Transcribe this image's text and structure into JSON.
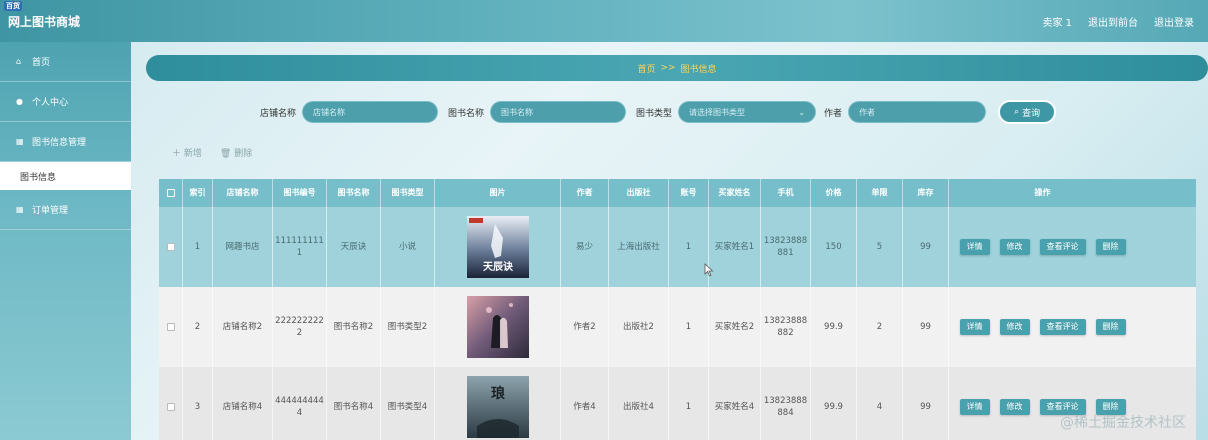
{
  "header": {
    "badge": "百货",
    "title": "网上图书商城",
    "user": "卖家 1",
    "back_to_admin": "退出到前台",
    "logout": "退出登录"
  },
  "sidebar": {
    "items": [
      {
        "label": "首页"
      },
      {
        "label": "个人中心"
      },
      {
        "label": "图书信息管理"
      },
      {
        "label": "订单管理"
      }
    ],
    "sub_item": "图书信息"
  },
  "breadcrumb": {
    "home": "首页",
    "sep": ">>",
    "current": "图书信息"
  },
  "search": {
    "store_label": "店铺名称",
    "store_placeholder": "店铺名称",
    "book_label": "图书名称",
    "book_placeholder": "图书名称",
    "type_label": "图书类型",
    "type_placeholder": "请选择图书类型",
    "author_label": "作者",
    "author_placeholder": "作者",
    "query_label": "查询"
  },
  "actions": {
    "add": "新增",
    "delete": "删除"
  },
  "table": {
    "columns": [
      "索引",
      "店铺名称",
      "图书编号",
      "图书名称",
      "图书类型",
      "图片",
      "作者",
      "出版社",
      "账号",
      "买家姓名",
      "手机",
      "价格",
      "单限",
      "库存",
      "操作"
    ],
    "rows": [
      {
        "idx": "1",
        "store": "网趣书店",
        "code": "1111111111",
        "name": "天辰诀",
        "type": "小说",
        "author": "易少",
        "publisher": "上海出版社",
        "account": "1",
        "buyer": "买家姓名1",
        "phone": "13823888881",
        "price": "150",
        "limit": "5",
        "stock": "99"
      },
      {
        "idx": "2",
        "store": "店铺名称2",
        "code": "2222222222",
        "name": "图书名称2",
        "type": "图书类型2",
        "author": "作者2",
        "publisher": "出版社2",
        "account": "1",
        "buyer": "买家姓名2",
        "phone": "13823888882",
        "price": "99.9",
        "limit": "2",
        "stock": "99"
      },
      {
        "idx": "3",
        "store": "店铺名称4",
        "code": "4444444444",
        "name": "图书名称4",
        "type": "图书类型4",
        "author": "作者4",
        "publisher": "出版社4",
        "account": "1",
        "buyer": "买家姓名4",
        "phone": "13823888884",
        "price": "99.9",
        "limit": "4",
        "stock": "99"
      }
    ],
    "ops": {
      "detail": "详情",
      "edit": "修改",
      "review": "查看评论",
      "remove": "删除"
    }
  },
  "cover_texts": [
    "天辰诀",
    "琅"
  ],
  "watermark": "@稀土掘金技术社区",
  "colors": {
    "accent": "#4aa1ae",
    "breadcrumb_text": "#ffd55a",
    "header": "#5fb0bd"
  }
}
